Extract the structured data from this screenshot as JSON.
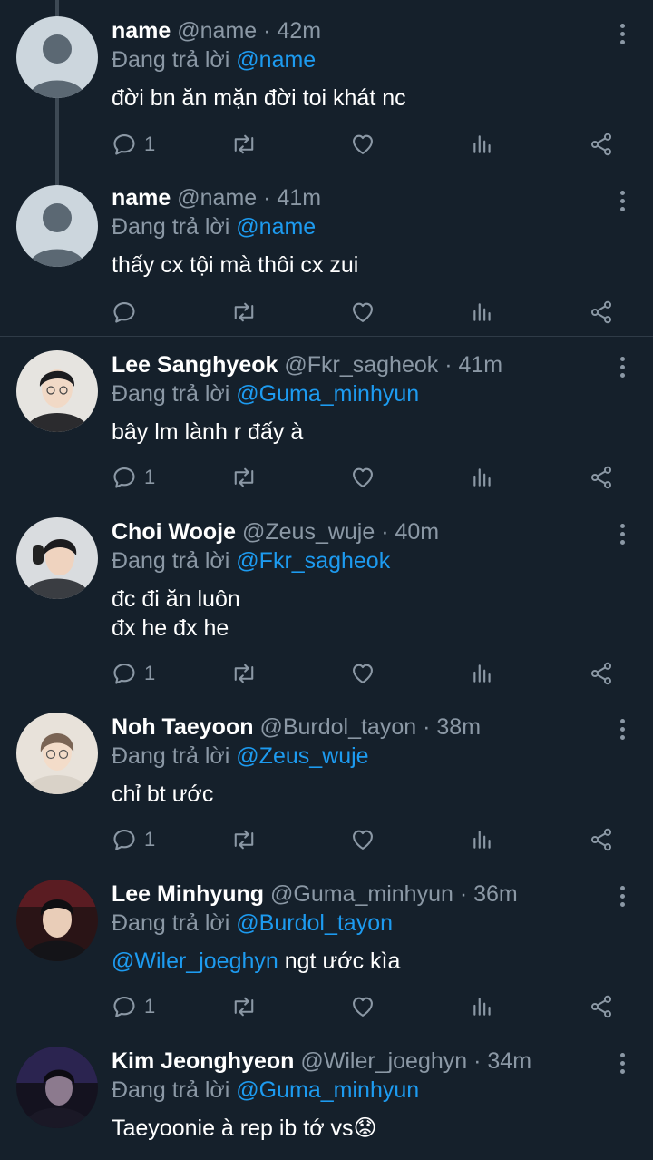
{
  "tweets": [
    {
      "name": "name",
      "handle": "@name",
      "time": "· 42m",
      "reply_prefix": "Đang trả lời",
      "reply_to": "@name",
      "body_mention": "",
      "body_text": "đời bn ăn mặn đời toi khát nc",
      "reply_count": "1",
      "avatar": "default-avatar"
    },
    {
      "name": "name",
      "handle": "@name",
      "time": "· 41m",
      "reply_prefix": "Đang trả lời",
      "reply_to": "@name",
      "body_mention": "",
      "body_text": "thấy cx tội mà thôi cx zui",
      "reply_count": "",
      "avatar": "default-avatar"
    },
    {
      "name": "Lee Sanghyeok",
      "handle": "@Fkr_sagheok",
      "time": "· 41m",
      "reply_prefix": "Đang trả lời",
      "reply_to": "@Guma_minhyun",
      "body_mention": "",
      "body_text": "bây lm lành r đấy à",
      "reply_count": "1",
      "avatar": "photo-avatar"
    },
    {
      "name": "Choi Wooje",
      "handle": "@Zeus_wuje",
      "time": "· 40m",
      "reply_prefix": "Đang trả lời",
      "reply_to": "@Fkr_sagheok",
      "body_mention": "",
      "body_text": "đc đi ăn luôn\nđx he đx he",
      "reply_count": "1",
      "avatar": "photo-avatar"
    },
    {
      "name": "Noh Taeyoon",
      "handle": "@Burdol_tayon",
      "time": "· 38m",
      "reply_prefix": "Đang trả lời",
      "reply_to": "@Zeus_wuje",
      "body_mention": "",
      "body_text": "chỉ bt ước",
      "reply_count": "1",
      "avatar": "photo-avatar"
    },
    {
      "name": "Lee Minhyung",
      "handle": "@Guma_minhyun",
      "time": "· 36m",
      "reply_prefix": "Đang trả lời",
      "reply_to": "@Burdol_tayon",
      "body_mention": "@Wiler_joeghyn",
      "body_text": " ngt ước kìa",
      "reply_count": "1",
      "avatar": "photo-avatar"
    },
    {
      "name": "Kim Jeonghyeon",
      "handle": "@Wiler_joeghyn",
      "time": "· 34m",
      "reply_prefix": "Đang trả lời",
      "reply_to": "@Guma_minhyun",
      "body_mention": "",
      "body_text": "Taeyoonie à rep ib tớ vs😟",
      "reply_count": "",
      "avatar": "photo-avatar"
    }
  ],
  "icons": {
    "reply": "reply-icon",
    "retweet": "retweet-icon",
    "like": "heart-icon",
    "views": "views-icon",
    "share": "share-icon",
    "more": "more-vertical-icon"
  },
  "colors": {
    "background": "#15202b",
    "muted": "#8b98a5",
    "link": "#1d9bf0",
    "thread_line": "#3d4954"
  }
}
